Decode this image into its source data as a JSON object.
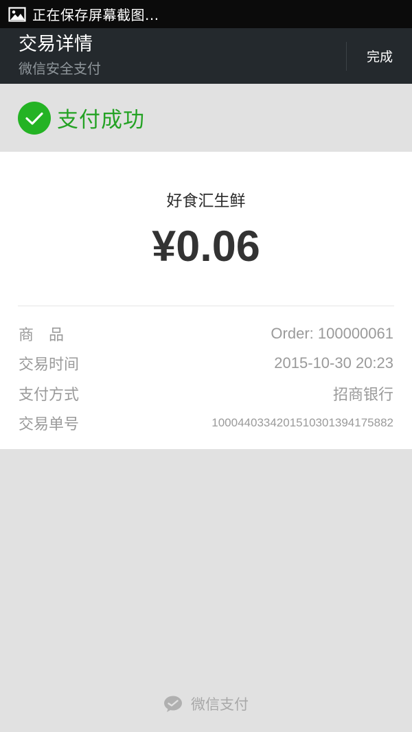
{
  "status_bar": {
    "text": "正在保存屏幕截图..."
  },
  "app_bar": {
    "title": "交易详情",
    "subtitle": "微信安全支付",
    "done_label": "完成"
  },
  "result": {
    "status_text": "支付成功",
    "accent_color": "#24a224"
  },
  "payment": {
    "merchant": "好食汇生鲜",
    "amount": "¥0.06"
  },
  "details": [
    {
      "label": "商　品",
      "value": "Order: 100000061"
    },
    {
      "label": "交易时间",
      "value": "2015-10-30 20:23"
    },
    {
      "label": "支付方式",
      "value": "招商银行"
    },
    {
      "label": "交易单号",
      "value": "1000440334201510301394175882"
    }
  ],
  "footer": {
    "text": "微信支付"
  }
}
